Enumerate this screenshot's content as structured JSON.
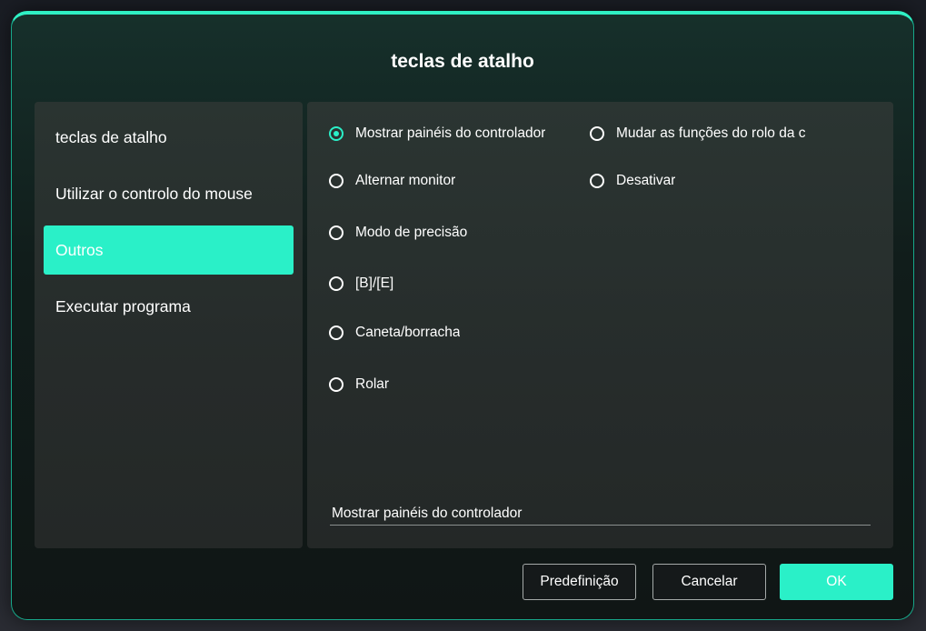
{
  "dialog": {
    "title": "teclas de atalho"
  },
  "sidebar": {
    "items": [
      {
        "label": "teclas de atalho",
        "active": false
      },
      {
        "label": "Utilizar o controlo do mouse",
        "active": false
      },
      {
        "label": "Outros",
        "active": true
      },
      {
        "label": "Executar programa",
        "active": false
      }
    ]
  },
  "options": {
    "left": [
      {
        "label": "Mostrar painéis do controlador",
        "checked": true
      },
      {
        "label": "Alternar monitor",
        "checked": false
      },
      {
        "label": "Modo de precisão",
        "checked": false
      },
      {
        "label": "[B]/[E]",
        "checked": false
      },
      {
        "label": "Caneta/borracha",
        "checked": false
      },
      {
        "label": "Rolar",
        "checked": false
      }
    ],
    "right": [
      {
        "label": "Mudar as funções do rolo da c",
        "checked": false
      },
      {
        "label": "Desativar",
        "checked": false
      }
    ],
    "selected_value": "Mostrar painéis do controlador"
  },
  "buttons": {
    "default_label": "Predefinição",
    "cancel_label": "Cancelar",
    "ok_label": "OK"
  },
  "colors": {
    "accent": "#2af0c8",
    "border": "#17a88a",
    "panel": "#262c2b"
  }
}
